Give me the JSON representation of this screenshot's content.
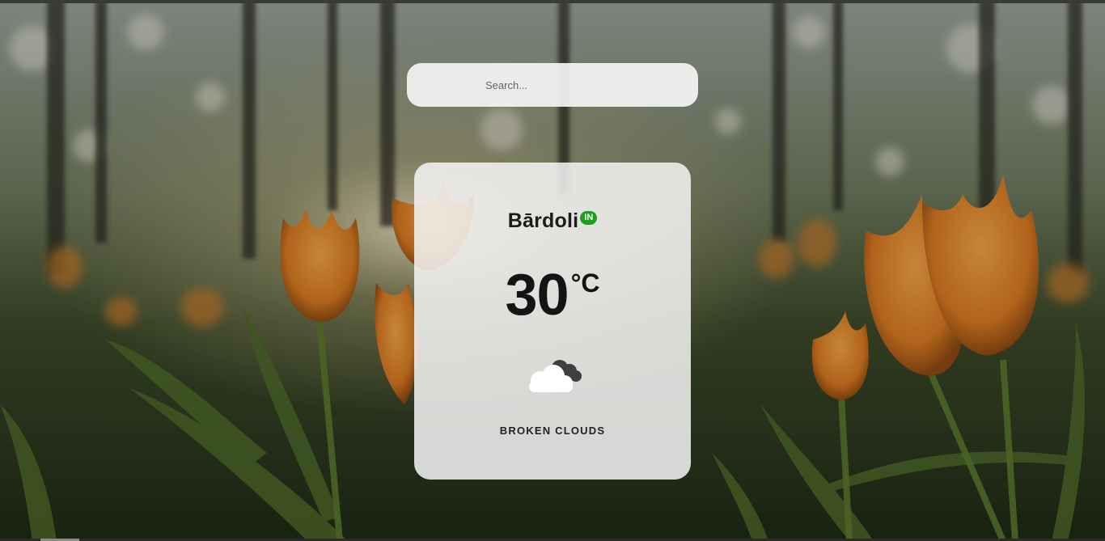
{
  "search": {
    "placeholder": "Search..."
  },
  "weather": {
    "city": "Bārdoli",
    "country_code": "IN",
    "temperature": "30",
    "unit": "°C",
    "description": "BROKEN CLOUDS",
    "icon": "broken-clouds-icon"
  },
  "colors": {
    "badge": "#1aa01a",
    "card": "#f4f4f4",
    "text": "#141414"
  }
}
